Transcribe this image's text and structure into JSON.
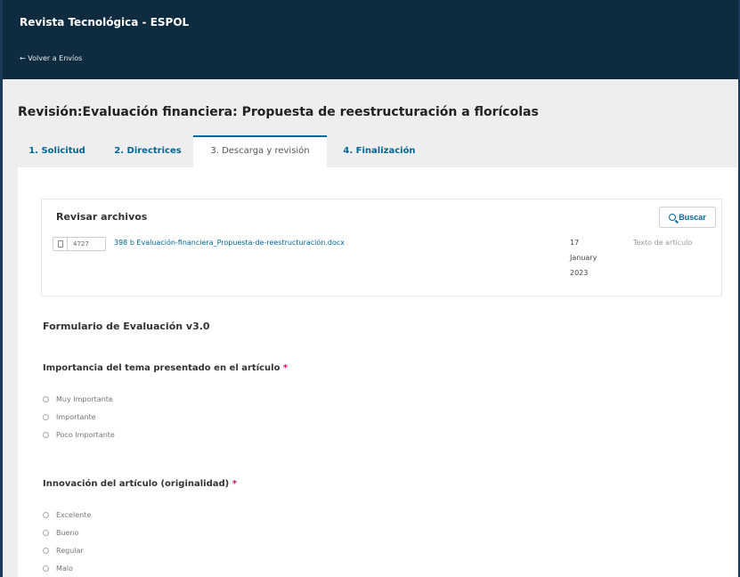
{
  "header": {
    "app_title": "Revista Tecnológica - ESPOL",
    "back_link": "← Volver a Envíos"
  },
  "page": {
    "title": "Revisión:Evaluación financiera: Propuesta de reestructuración a florícolas"
  },
  "tabs": [
    {
      "label": "1. Solicitud",
      "active": false
    },
    {
      "label": "2. Directrices",
      "active": false
    },
    {
      "label": "3. Descarga y revisión",
      "active": true
    },
    {
      "label": "4. Finalización",
      "active": false
    }
  ],
  "files": {
    "heading": "Revisar archivos",
    "search_label": "Buscar",
    "rows": [
      {
        "id": "4727",
        "name": "398 b Evaluación-financiera_Propuesta-de-reestructuración.docx",
        "date_day": "17",
        "date_month": "January",
        "date_year": "2023",
        "type": "Texto de artículo"
      }
    ]
  },
  "form": {
    "title": "Formulario de Evaluación v3.0",
    "questions": [
      {
        "title": "Importancia del tema presentado en el artículo",
        "required_mark": "*",
        "options": [
          "Muy Importante",
          "Importante",
          "Poco Importante"
        ]
      },
      {
        "title": "Innovación del artículo (originalidad)",
        "required_mark": "*",
        "options": [
          "Excelente",
          "Bueno",
          "Regular",
          "Malo"
        ]
      }
    ]
  },
  "colors": {
    "header_bg": "#0e2b40",
    "link": "#006798",
    "required": "#d00a6c"
  }
}
